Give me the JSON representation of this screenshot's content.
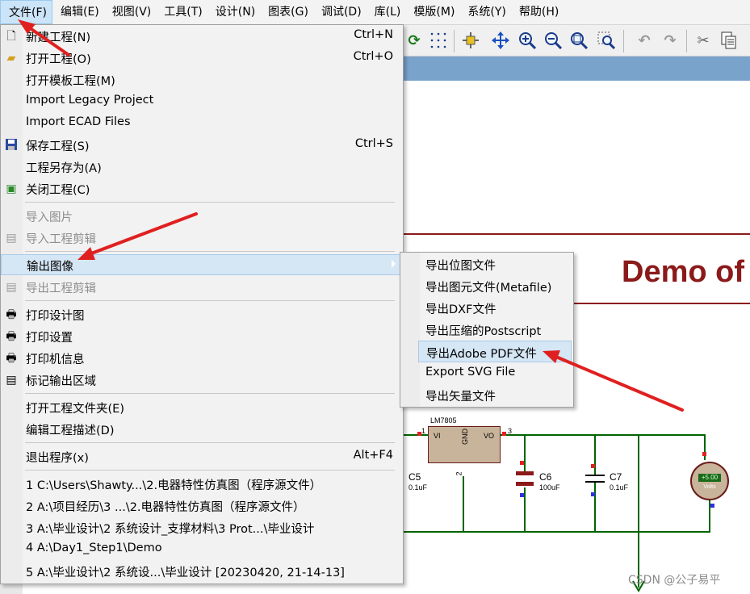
{
  "menubar": {
    "items": [
      "文件(F)",
      "编辑(E)",
      "视图(V)",
      "工具(T)",
      "设计(N)",
      "图表(G)",
      "调试(D)",
      "库(L)",
      "模版(M)",
      "系统(Y)",
      "帮助(H)"
    ]
  },
  "file_menu": {
    "items": [
      {
        "label": "新建工程(N)",
        "shortcut": "Ctrl+N",
        "icon": "new-file-icon"
      },
      {
        "label": "打开工程(O)",
        "shortcut": "Ctrl+O",
        "icon": "open-folder-icon"
      },
      {
        "label": "打开模板工程(M)",
        "shortcut": ""
      },
      {
        "label": "Import Legacy Project",
        "shortcut": ""
      },
      {
        "label": "Import ECAD Files",
        "shortcut": ""
      },
      {
        "label": "保存工程(S)",
        "shortcut": "Ctrl+S",
        "icon": "save-icon"
      },
      {
        "label": "工程另存为(A)",
        "shortcut": ""
      },
      {
        "label": "关闭工程(C)",
        "shortcut": "",
        "icon": "close-project-icon"
      },
      {
        "label": "导入图片",
        "shortcut": "",
        "disabled": true
      },
      {
        "label": "导入工程剪辑",
        "shortcut": "",
        "disabled": true,
        "icon": "import-clip-icon"
      },
      {
        "label": "输出图像",
        "shortcut": "",
        "submenu": true
      },
      {
        "label": "导出工程剪辑",
        "shortcut": "",
        "disabled": true,
        "icon": "export-clip-icon"
      },
      {
        "label": "打印设计图",
        "shortcut": "",
        "icon": "print-icon"
      },
      {
        "label": "打印设置",
        "shortcut": "",
        "icon": "print-setup-icon"
      },
      {
        "label": "打印机信息",
        "shortcut": "",
        "icon": "printer-info-icon"
      },
      {
        "label": "标记输出区域",
        "shortcut": "",
        "icon": "mark-area-icon"
      },
      {
        "label": "打开工程文件夹(E)",
        "shortcut": ""
      },
      {
        "label": "编辑工程描述(D)",
        "shortcut": ""
      },
      {
        "label": "退出程序(x)",
        "shortcut": "Alt+F4"
      },
      {
        "label": "1 C:\\Users\\Shawty...\\2.电器特性仿真图（程序源文件）",
        "shortcut": ""
      },
      {
        "label": "2 A:\\项目经历\\3 ...\\2.电器特性仿真图（程序源文件）",
        "shortcut": ""
      },
      {
        "label": "3 A:\\毕业设计\\2 系统设计_支撑材料\\3 Prot...\\毕业设计",
        "shortcut": ""
      },
      {
        "label": "4 A:\\Day1_Step1\\Demo",
        "shortcut": ""
      },
      {
        "label": "5 A:\\毕业设计\\2 系统设...\\毕业设计 [20230420, 21-14-13]",
        "shortcut": ""
      }
    ]
  },
  "export_submenu": {
    "items": [
      "导出位图文件",
      "导出图元文件(Metafile)",
      "导出DXF文件",
      "导出压缩的Postscript",
      "导出Adobe PDF文件",
      "Export SVG File",
      "导出矢量文件"
    ]
  },
  "schematic": {
    "title": "Demo of",
    "ic_name": "LM7805",
    "ic_pin_vi": "VI",
    "ic_pin_vo": "VO",
    "ic_pin_gnd": "GND",
    "pin_1": "1",
    "pin_2": "2",
    "pin_3": "3",
    "c5_label": "C5",
    "c5_value": "0.1uF",
    "c6_label": "C6",
    "c6_value": "100uF",
    "c7_label": "C7",
    "c7_value": "0.1uF",
    "voltmeter_display": "+5.00",
    "voltmeter_unit": "Volts"
  },
  "watermark": "CSDN @公子易平",
  "colors": {
    "sheet_red": "#8b1a1a",
    "wire_green": "#006400",
    "highlight": "#d5e6f5",
    "arrow_red": "#e02020"
  }
}
